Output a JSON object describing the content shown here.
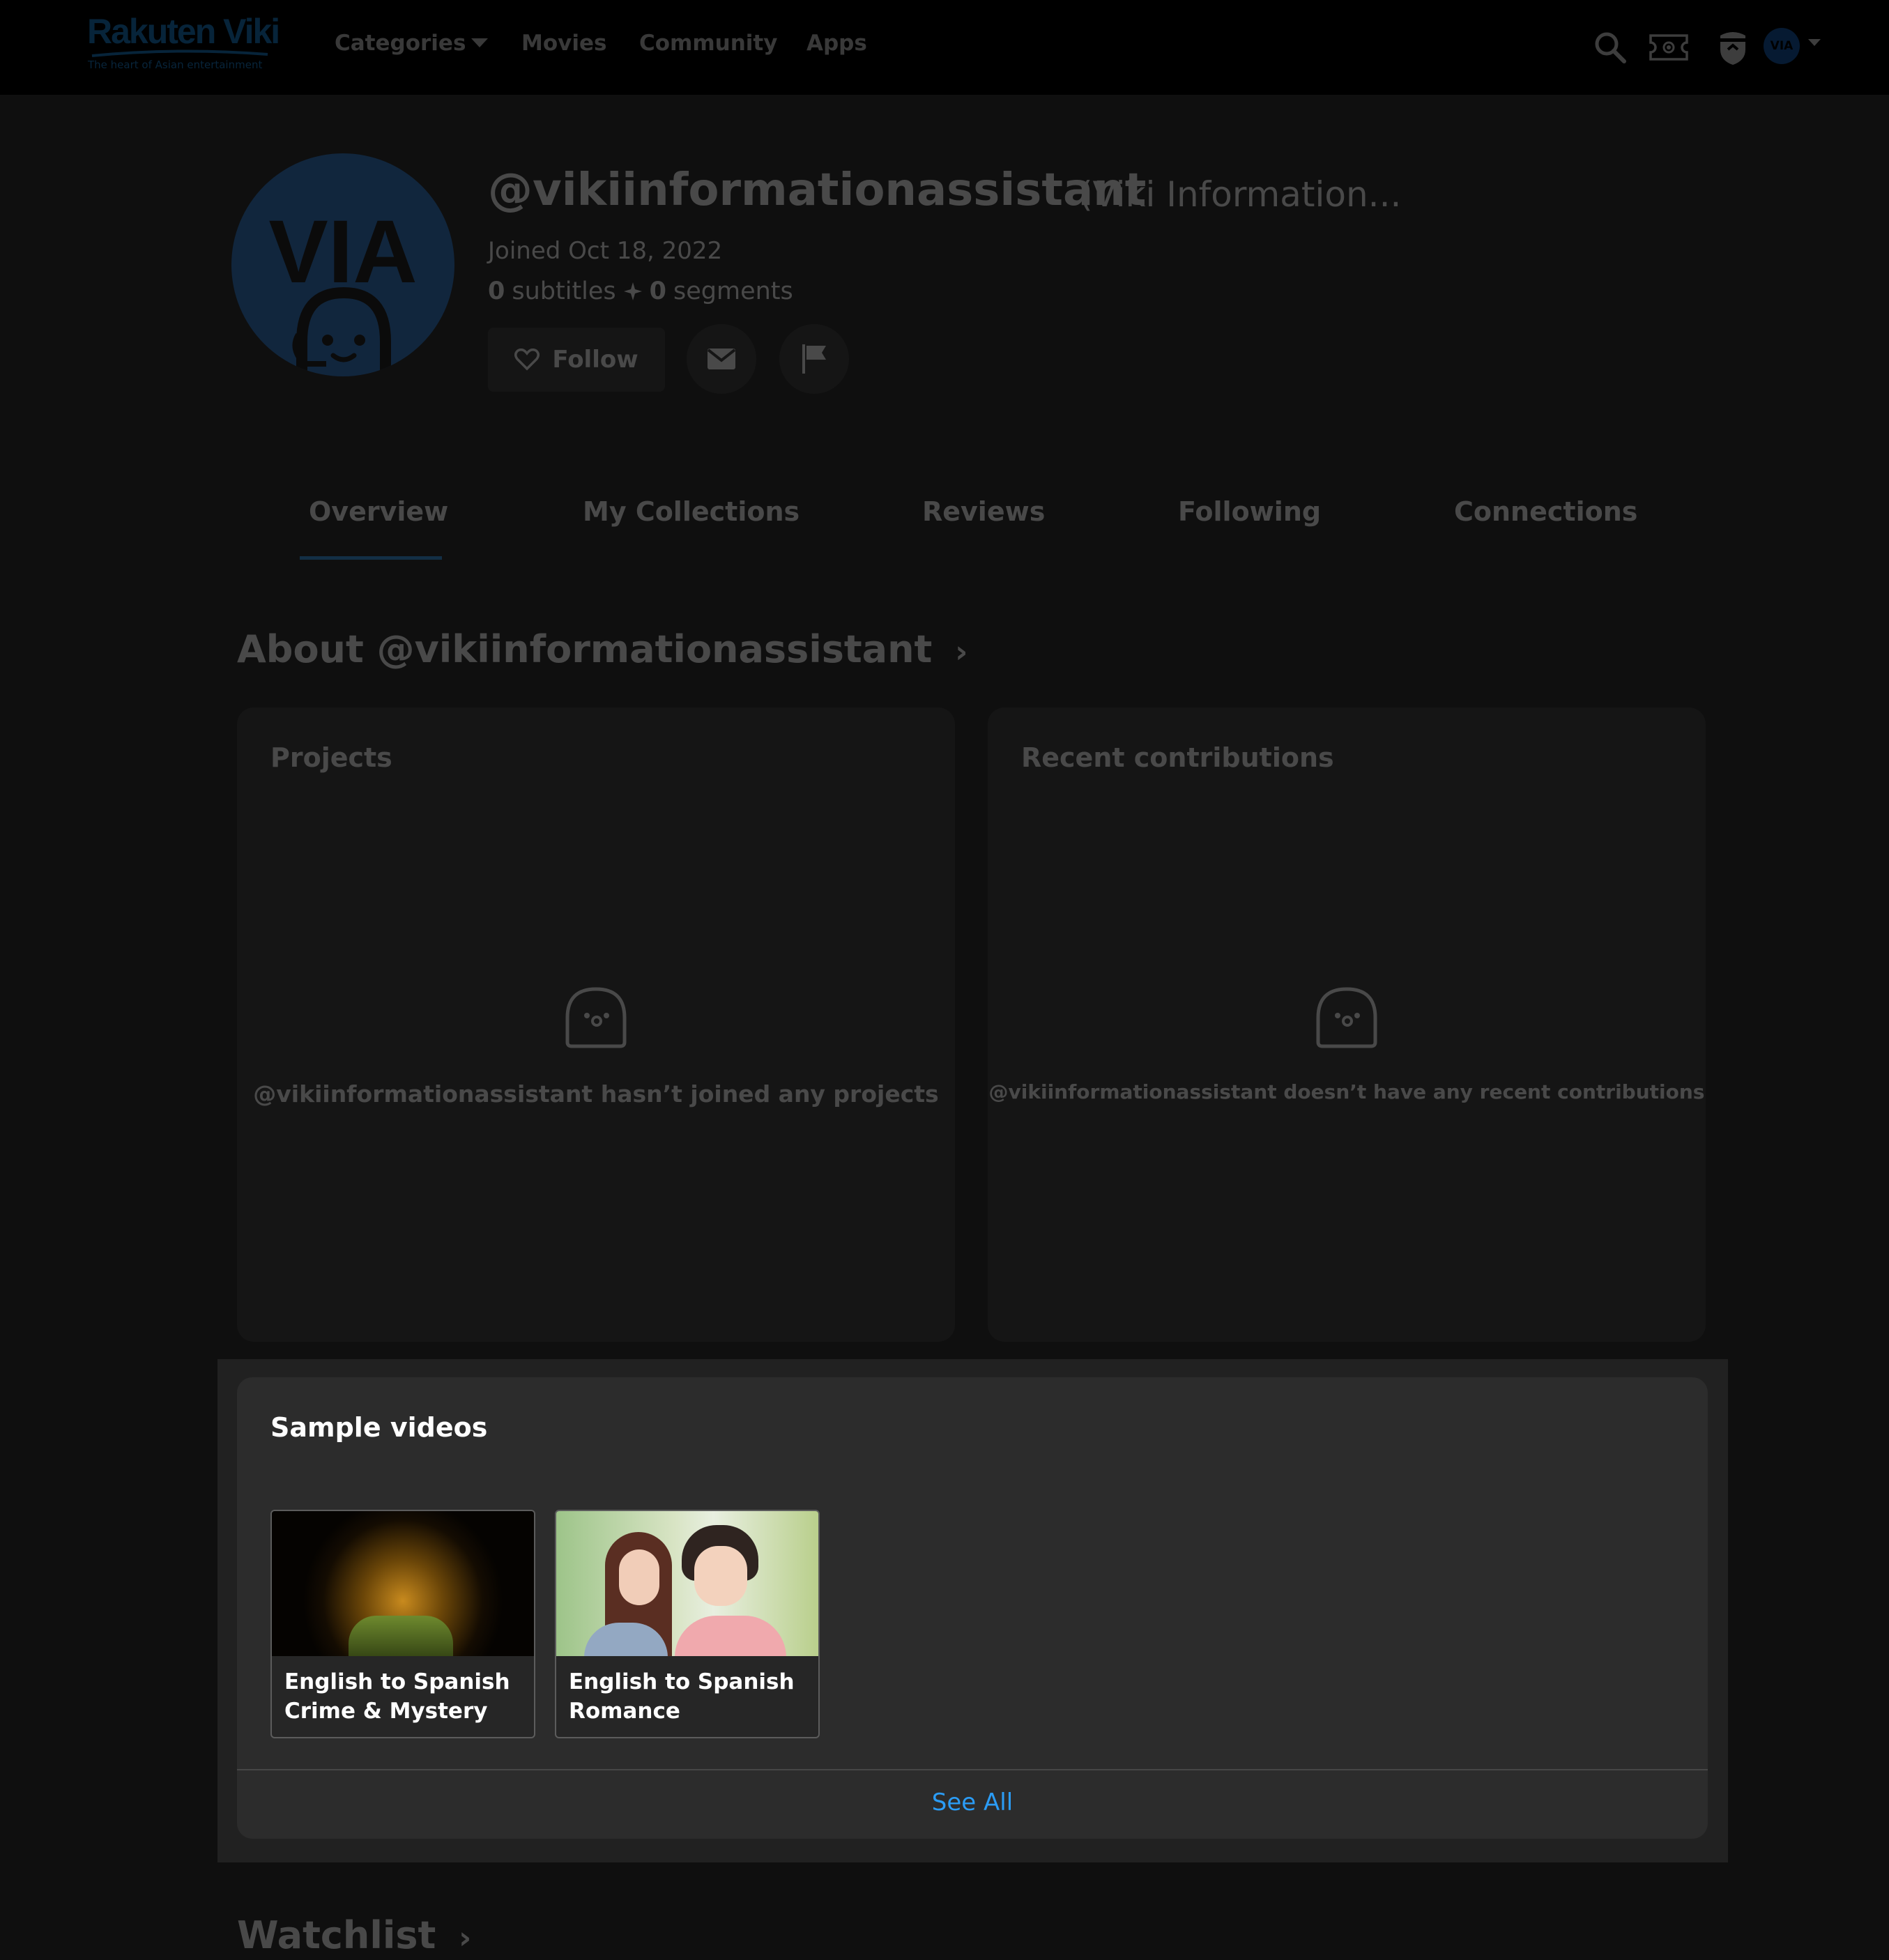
{
  "header": {
    "logo": "Rakuten Viki",
    "tagline": "The heart of Asian entertainment",
    "nav": {
      "categories": "Categories",
      "movies": "Movies",
      "community": "Community",
      "apps": "Apps"
    },
    "user_avatar_initials": "VIA",
    "accent_color": "#2196f3"
  },
  "profile": {
    "avatar_initials": "VIA",
    "handle": "@vikiinformationassistant",
    "display_name": "(Viki Information...",
    "joined": "Joined Oct 18, 2022",
    "subtitles_count": "0",
    "subtitles_label": "subtitles",
    "segments_count": "0",
    "segments_label": "segments",
    "follow_label": "Follow"
  },
  "tabs": {
    "overview": "Overview",
    "collections": "My Collections",
    "reviews": "Reviews",
    "following": "Following",
    "connections": "Connections",
    "active": "Overview"
  },
  "about": {
    "title": "About @vikiinformationassistant",
    "projects_title": "Projects",
    "projects_empty": "@vikiinformationassistant hasn’t joined any projects",
    "contributions_title": "Recent contributions",
    "contributions_empty": "@vikiinformationassistant doesn’t have any recent contributions"
  },
  "sample_videos": {
    "title": "Sample videos",
    "items": [
      {
        "line1": "English to Spanish",
        "line2": "Crime & Mystery"
      },
      {
        "line1": "English to Spanish",
        "line2": "Romance"
      }
    ],
    "see_all": "See All"
  },
  "watchlist": {
    "title": "Watchlist"
  }
}
